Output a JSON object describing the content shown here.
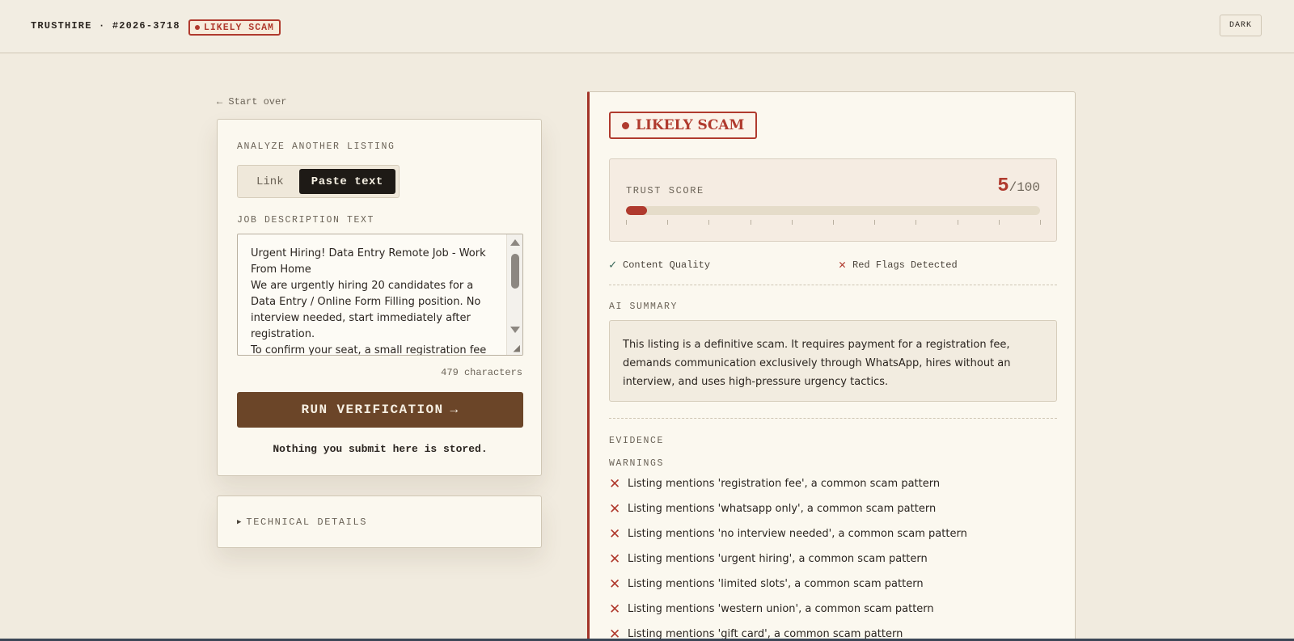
{
  "header": {
    "brand": "TRUSTHIRE · #2026-3718",
    "badge": "LIKELY SCAM",
    "theme_toggle": "DARK"
  },
  "nav": {
    "start_over": "← Start over"
  },
  "form": {
    "section_label": "ANALYZE ANOTHER LISTING",
    "tabs": {
      "link": "Link",
      "paste": "Paste text",
      "selected": "Paste text"
    },
    "field_label": "JOB DESCRIPTION TEXT",
    "field_value": "Urgent Hiring! Data Entry Remote Job - Work From Home\nWe are urgently hiring 20 candidates for a Data Entry / Online Form Filling position. No interview needed, start immediately after registration.\nTo confirm your seat, a small registration fee of",
    "char_count": "479 characters",
    "submit_label": "RUN VERIFICATION",
    "submit_arrow": "→",
    "privacy_note": "Nothing you submit here is stored."
  },
  "technical": {
    "label": "TECHNICAL DETAILS",
    "expanded": false
  },
  "result": {
    "verdict": "LIKELY SCAM",
    "trust_score_label": "TRUST SCORE",
    "score": "5",
    "score_max": "/100",
    "score_fraction": 0.05,
    "checks": [
      {
        "label": "Content Quality",
        "status": "pass",
        "icon": "check-icon"
      },
      {
        "label": "Red Flags Detected",
        "status": "fail",
        "icon": "x-icon"
      }
    ],
    "ai_summary_label": "AI SUMMARY",
    "ai_summary": "This listing is a definitive scam. It requires payment for a registration fee, demands communication exclusively through WhatsApp, hires without an interview, and uses high-pressure urgency tactics.",
    "evidence_label": "EVIDENCE",
    "warnings_label": "WARNINGS",
    "warnings": [
      "Listing mentions 'registration fee', a common scam pattern",
      "Listing mentions 'whatsapp only', a common scam pattern",
      "Listing mentions 'no interview needed', a common scam pattern",
      "Listing mentions 'urgent hiring', a common scam pattern",
      "Listing mentions 'limited slots', a common scam pattern",
      "Listing mentions 'western union', a common scam pattern",
      "Listing mentions 'gift card', a common scam pattern"
    ]
  },
  "colors": {
    "background": "#f1ebdf",
    "danger": "#b03a2e",
    "primary_button": "#6b4528",
    "ok": "#3d6b5d"
  }
}
